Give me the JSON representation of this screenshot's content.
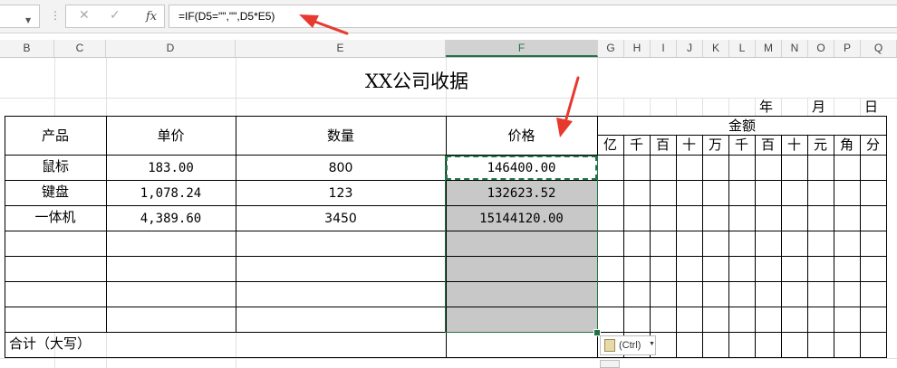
{
  "formula_bar": {
    "formula": "=IF(D5=\"\",\"\",D5*E5)",
    "fx_label": "fx",
    "cancel_glyph": "✕",
    "enter_glyph": "✓"
  },
  "columns": [
    "B",
    "C",
    "D",
    "E",
    "F",
    "G",
    "H",
    "I",
    "J",
    "K",
    "L",
    "M",
    "N",
    "O",
    "P",
    "Q"
  ],
  "selected_column": "F",
  "sheet": {
    "title": "XX公司收据",
    "date_labels": {
      "year": "年",
      "month": "月",
      "day": "日"
    },
    "headers": {
      "product": "产品",
      "unit_price": "单价",
      "quantity": "数量",
      "price": "价格",
      "amount": "金额"
    },
    "digit_units": [
      "亿",
      "千",
      "百",
      "十",
      "万",
      "千",
      "百",
      "十",
      "元",
      "角",
      "分"
    ],
    "rows": [
      {
        "product": "鼠标",
        "unit_price": "183.00",
        "quantity": "800",
        "price": "146400.00"
      },
      {
        "product": "键盘",
        "unit_price": "1,078.24",
        "quantity": "123",
        "price": "132623.52"
      },
      {
        "product": "一体机",
        "unit_price": "4,389.60",
        "quantity": "3450",
        "price": "15144120.00"
      }
    ],
    "total_label": "合计（大写）"
  },
  "paste_options": {
    "label": "(Ctrl)"
  },
  "colors": {
    "accent": "#217346",
    "arrow": "#e8392e",
    "selection_fill": "#c8c8c8"
  },
  "icons": [
    "dropdown-arrow-icon",
    "cancel-icon",
    "enter-icon",
    "fx-icon",
    "paste-clipboard-icon",
    "red-arrow-icon"
  ]
}
